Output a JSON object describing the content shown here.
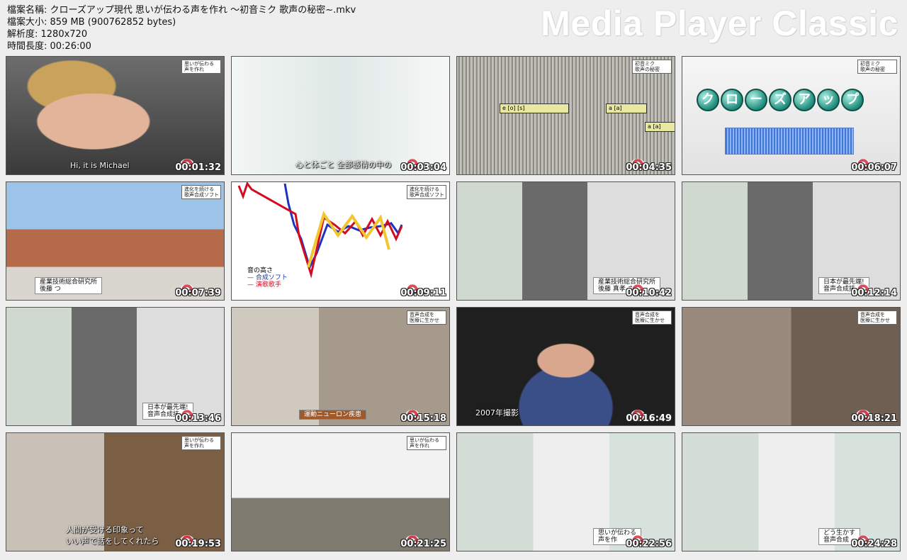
{
  "file_info": {
    "name_line": "檔案名稱: クローズアップ現代 思いが伝わる声を作れ ～初音ミク 歌声の秘密~.mkv",
    "size_line": "檔案大小: 859 MB (900762852 bytes)",
    "resolution_line": "解析度: 1280x720",
    "duration_line": "時間長度: 00:26:00"
  },
  "brand": "Media Player Classic",
  "thumbnails": [
    {
      "timestamp": "00:01:32",
      "scene": "man-face",
      "badge": "思いが伝わる\n声を作れ",
      "caption": "Hi, it is Michael"
    },
    {
      "timestamp": "00:03:04",
      "scene": "studio-miku",
      "badge": "",
      "caption": "心と体ごと 全部感情の中の"
    },
    {
      "timestamp": "00:04:35",
      "scene": "spectrogram",
      "badge": "初音ミク\n歌声の秘密",
      "caption": ""
    },
    {
      "timestamp": "00:06:07",
      "scene": "closeup-title",
      "badge": "初音ミク\n歌声の秘密",
      "caption": ""
    },
    {
      "timestamp": "00:07:39",
      "scene": "building",
      "badge": "進化を続ける\n歌声合成ソフト",
      "caption": "",
      "lower_third": "産業技術総合研究所\n後藤 つ"
    },
    {
      "timestamp": "00:09:11",
      "scene": "pitch-graph",
      "badge": "進化を続ける\n歌声合成ソフト",
      "caption": "",
      "legend_title": "音の高さ",
      "legend_items": [
        "— 合成ソフト",
        "— 演歌歌手"
      ]
    },
    {
      "timestamp": "00:10:42",
      "scene": "studio-man",
      "badge": "",
      "caption": "",
      "lower_third": "産業技術総合研究所\n後藤 真孝 さん"
    },
    {
      "timestamp": "00:12:14",
      "scene": "studio-man",
      "badge": "",
      "caption": "",
      "lower_third": "日本が最先端!\n音声合成技"
    },
    {
      "timestamp": "00:13:46",
      "scene": "studio-man",
      "badge": "",
      "caption": "",
      "lower_third": "日本が最先端!\n音声合成技"
    },
    {
      "timestamp": "00:15:18",
      "scene": "wheelchair",
      "badge": "音声合成を\n医療に生かせ",
      "caption": "",
      "lower_third": "運動ニューロン疾患"
    },
    {
      "timestamp": "00:16:49",
      "scene": "dark-man",
      "badge": "音声合成を\n医療に生かせ",
      "caption": "2007年撮影"
    },
    {
      "timestamp": "00:18:21",
      "scene": "woman-headphones",
      "badge": "音声合成を\n医療に生かせ",
      "caption": ""
    },
    {
      "timestamp": "00:19:53",
      "scene": "glasses-man",
      "badge": "思いが伝わる\n声を作れ",
      "caption": "人間が受ける印象って\nいい声で話をしてくれたら"
    },
    {
      "timestamp": "00:21:25",
      "scene": "whiteboard",
      "badge": "思いが伝わる\n声を作れ",
      "caption": ""
    },
    {
      "timestamp": "00:22:56",
      "scene": "studio-woman",
      "badge": "",
      "caption": "",
      "lower_third": "思いが伝わる\n声を作"
    },
    {
      "timestamp": "00:24:28",
      "scene": "studio-woman",
      "badge": "",
      "caption": "",
      "lower_third": "どう生かす\n音声合成"
    }
  ],
  "closeup_title": [
    "ク",
    "ロ",
    "ー",
    "ズ",
    "ア",
    "ッ",
    "プ"
  ],
  "spectro_boxes": [
    "e [o] [s]",
    "a [a]",
    "a [a]"
  ],
  "colors": {
    "background": "#eeeeee",
    "logo_red": "#d83a4a"
  }
}
